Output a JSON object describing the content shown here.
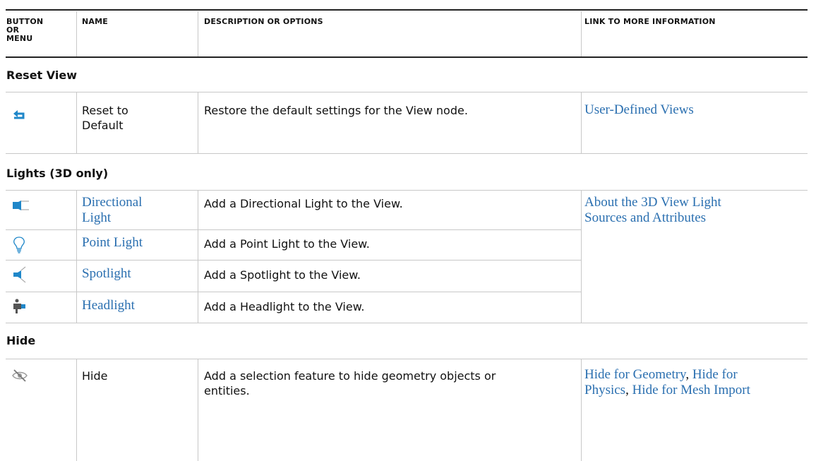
{
  "header": {
    "col_button": "BUTTON OR MENU",
    "col_button_lines": [
      "BUTTON",
      "OR",
      "MENU"
    ],
    "col_name": "NAME",
    "col_description": "DESCRIPTION OR OPTIONS",
    "col_link": "LINK TO MORE INFORMATION"
  },
  "sections": [
    {
      "title": "Reset View",
      "rows": [
        {
          "icon": "reset-arrow-icon",
          "name_lines": [
            "Reset to",
            "Default"
          ],
          "name_is_link": false,
          "description_lines": [
            "Restore the default settings for the View node."
          ],
          "link_lines": [
            "User-Defined Views"
          ]
        }
      ]
    },
    {
      "title": "Lights (3D only)",
      "rows": [
        {
          "icon": "directional-light-icon",
          "name_lines": [
            "Directional",
            "Light"
          ],
          "name_is_link": true,
          "description_lines": [
            "Add a Directional Light to the View."
          ],
          "link_lines": [
            "About the 3D View Light",
            "Sources and Attributes"
          ]
        },
        {
          "icon": "point-light-icon",
          "name_lines": [
            "Point Light"
          ],
          "name_is_link": true,
          "description_lines": [
            "Add a Point Light to the View."
          ]
        },
        {
          "icon": "spotlight-icon",
          "name_lines": [
            "Spotlight"
          ],
          "name_is_link": true,
          "description_lines": [
            "Add a Spotlight to the View."
          ]
        },
        {
          "icon": "headlight-icon",
          "name_lines": [
            "Headlight"
          ],
          "name_is_link": true,
          "description_lines": [
            "Add a Headlight to the View."
          ]
        }
      ]
    },
    {
      "title": "Hide",
      "rows": [
        {
          "icon": "hide-eye-icon",
          "name_lines": [
            "Hide"
          ],
          "name_is_link": false,
          "description_lines": [
            "Add a selection feature to hide geometry objects or",
            "entities."
          ],
          "link_parts": {
            "line1_a": "Hide for Geometry",
            "line1_sep": ", ",
            "line1_b": "Hide for",
            "line2_a": "Physics",
            "line2_sep": ", ",
            "line2_b": "Hide for Mesh Import"
          }
        }
      ]
    }
  ],
  "colors": {
    "link": "#2a6fb0",
    "icon_blue": "#1f87c9",
    "rule": "#222222",
    "grid": "#c8c8c8"
  }
}
